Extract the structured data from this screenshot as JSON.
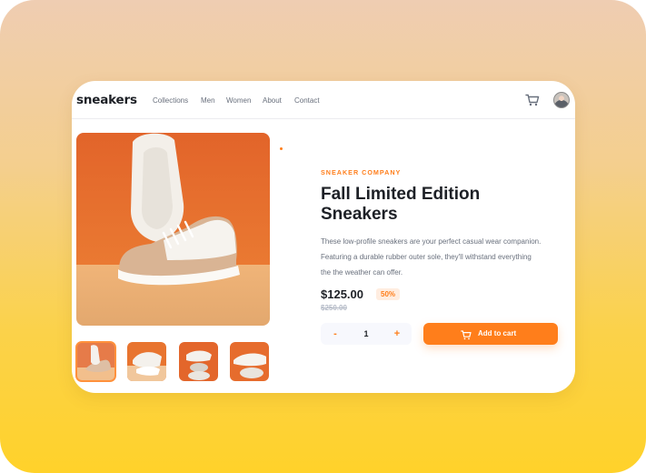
{
  "nav": {
    "logo": "sneakers",
    "links": [
      "Collections",
      "Men",
      "Women",
      "About",
      "Contact"
    ],
    "cart_icon": "cart-icon",
    "avatar": "user-avatar"
  },
  "product": {
    "company": "SNEAKER COMPANY",
    "title_line1": "Fall Limited Edition",
    "title_line2": "Sneakers",
    "description": "These low-profile sneakers are your perfect casual wear companion. Featuring a durable rubber outer sole, they'll withstand everything the the weather can offer.",
    "price": "$125.00",
    "discount": "50%",
    "old_price": "$250.00"
  },
  "cart": {
    "minus": "-",
    "quantity": "1",
    "plus": "+",
    "add_label": "Add to cart"
  },
  "colors": {
    "accent": "#ff7e1b",
    "accent_pale": "#ffede0",
    "dark_text": "#1d2026",
    "grey_text": "#69707d"
  }
}
